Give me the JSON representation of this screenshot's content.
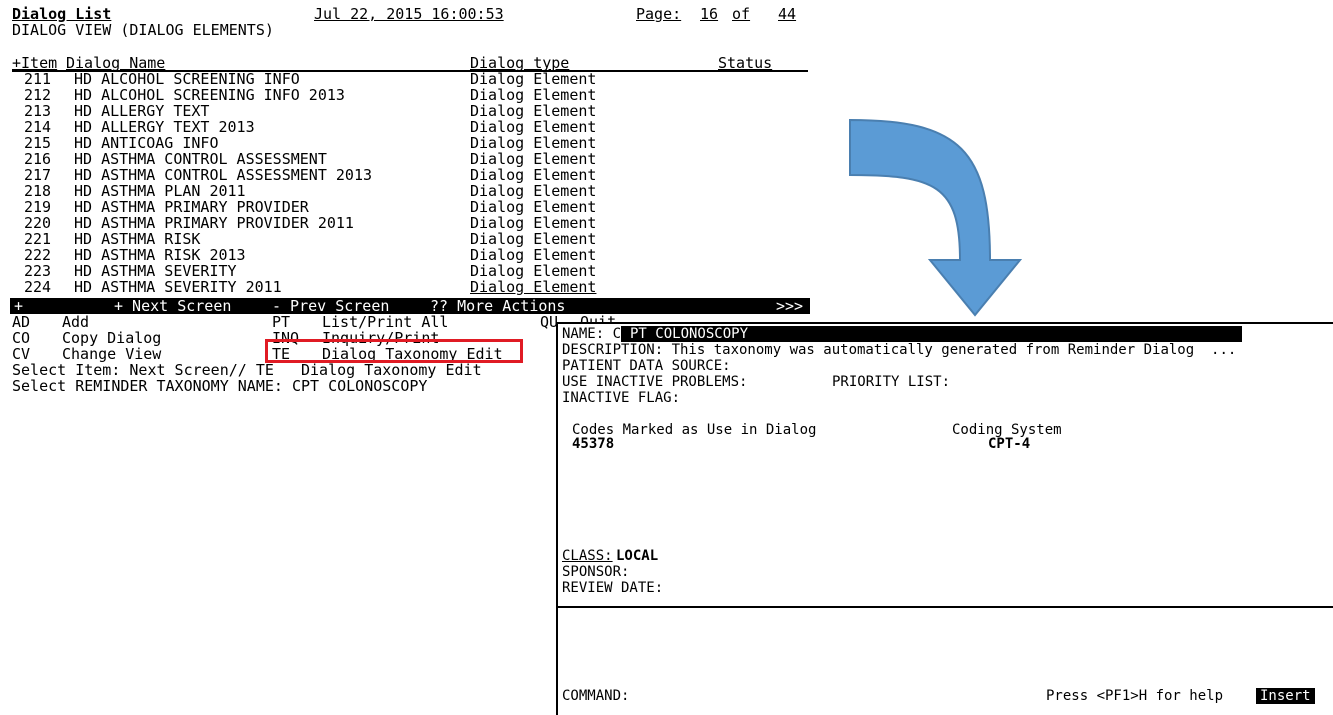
{
  "left": {
    "title": "Dialog List",
    "datetime": "Jul 22, 2015 16:00:53",
    "page_label": "Page:",
    "page_current": "16",
    "page_of": "of",
    "page_total": "44",
    "view_title": "DIALOG VIEW (DIALOG ELEMENTS)",
    "columns": {
      "item": "+Item",
      "name": "Dialog Name",
      "type": "Dialog type",
      "status": "Status"
    },
    "rows": [
      {
        "num": "211",
        "name": "HD ALCOHOL SCREENING INFO",
        "type": "Dialog Element"
      },
      {
        "num": "212",
        "name": "HD ALCOHOL SCREENING INFO 2013",
        "type": "Dialog Element"
      },
      {
        "num": "213",
        "name": "HD ALLERGY TEXT",
        "type": "Dialog Element"
      },
      {
        "num": "214",
        "name": "HD ALLERGY TEXT 2013",
        "type": "Dialog Element"
      },
      {
        "num": "215",
        "name": "HD ANTICOAG INFO",
        "type": "Dialog Element"
      },
      {
        "num": "216",
        "name": "HD ASTHMA CONTROL ASSESSMENT",
        "type": "Dialog Element"
      },
      {
        "num": "217",
        "name": "HD ASTHMA CONTROL ASSESSMENT 2013",
        "type": "Dialog Element"
      },
      {
        "num": "218",
        "name": "HD ASTHMA PLAN 2011",
        "type": "Dialog Element"
      },
      {
        "num": "219",
        "name": "HD ASTHMA PRIMARY PROVIDER",
        "type": "Dialog Element"
      },
      {
        "num": "220",
        "name": "HD ASTHMA PRIMARY PROVIDER 2011",
        "type": "Dialog Element"
      },
      {
        "num": "221",
        "name": "HD ASTHMA RISK",
        "type": "Dialog Element"
      },
      {
        "num": "222",
        "name": "HD ASTHMA RISK 2013",
        "type": "Dialog Element"
      },
      {
        "num": "223",
        "name": "HD ASTHMA SEVERITY",
        "type": "Dialog Element"
      },
      {
        "num": "224",
        "name": "HD ASTHMA SEVERITY 2011",
        "type": "Dialog Element"
      }
    ],
    "bar": {
      "plus": "+",
      "next": "+ Next Screen",
      "prev": "- Prev Screen",
      "more": "?? More Actions",
      "arrows": ">>>"
    },
    "actions": [
      {
        "code": "AD",
        "label": "Add"
      },
      {
        "code": "CO",
        "label": "Copy Dialog"
      },
      {
        "code": "CV",
        "label": "Change View"
      },
      {
        "code": "PT",
        "label": "List/Print All"
      },
      {
        "code": "INQ",
        "label": "Inquiry/Print"
      },
      {
        "code": "TE",
        "label": "Dialog Taxonomy Edit"
      },
      {
        "code": "QU",
        "label": "Quit"
      }
    ],
    "prompt1": "Select Item: Next Screen// TE   Dialog Taxonomy Edit",
    "prompt2": "Select REMINDER TAXONOMY NAME: CPT COLONOSCOPY"
  },
  "right": {
    "name_label": "NAME: C",
    "name_value": "PT COLONOSCOPY",
    "description": "DESCRIPTION: This taxonomy was automatically generated from Reminder Dialog  ...",
    "patient_data_source": "PATIENT DATA SOURCE:",
    "use_inactive_problems": "USE INACTIVE PROBLEMS:",
    "priority_list": "PRIORITY LIST:",
    "inactive_flag": "INACTIVE FLAG:",
    "codes_header": "Codes Marked as Use in Dialog",
    "coding_system_header": "Coding System",
    "code_value": "45378",
    "coding_system_value": "CPT-4",
    "class_label": "CLASS:",
    "class_value": "LOCAL",
    "sponsor": "SPONSOR:",
    "review_date": "REVIEW DATE:",
    "command": "COMMAND:",
    "help": "Press <PF1>H for help",
    "insert": "Insert"
  },
  "colors": {
    "highlight": "#e01b24",
    "arrow": "#5b9bd5",
    "arrow_edge": "#4a7fb0"
  },
  "icons": {
    "arrow": "curved-down-arrow"
  }
}
